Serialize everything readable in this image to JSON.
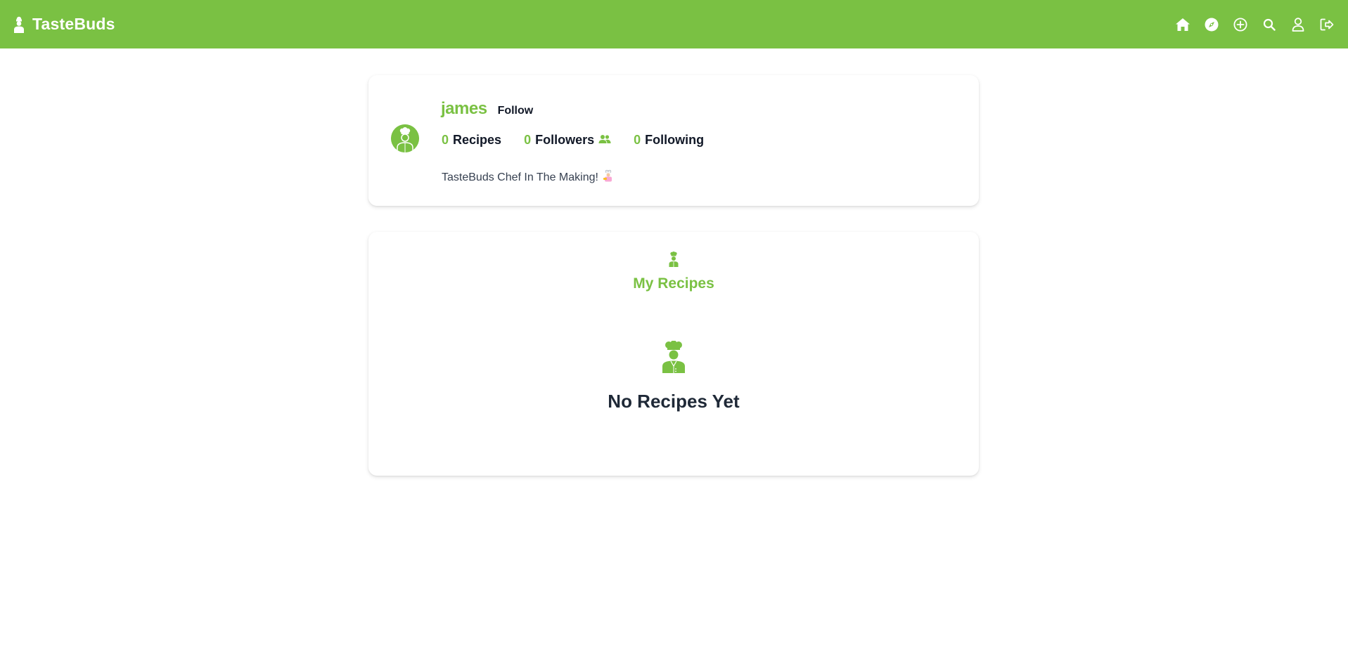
{
  "app": {
    "brand": "TasteBuds",
    "accent_color": "#7ac143"
  },
  "nav": {
    "icons": [
      "home-icon",
      "explore-icon",
      "add-recipe-icon",
      "search-icon",
      "profile-icon",
      "logout-icon"
    ]
  },
  "profile": {
    "username": "james",
    "follow_label": "Follow",
    "recipes_count": "0",
    "recipes_label": "Recipes",
    "followers_count": "0",
    "followers_label": "Followers",
    "following_count": "0",
    "following_label": "Following",
    "bio": "TasteBuds Chef In The Making!",
    "bio_emoji": "cook-emoji"
  },
  "recipes_section": {
    "title": "My Recipes",
    "empty_message": "No Recipes Yet"
  }
}
